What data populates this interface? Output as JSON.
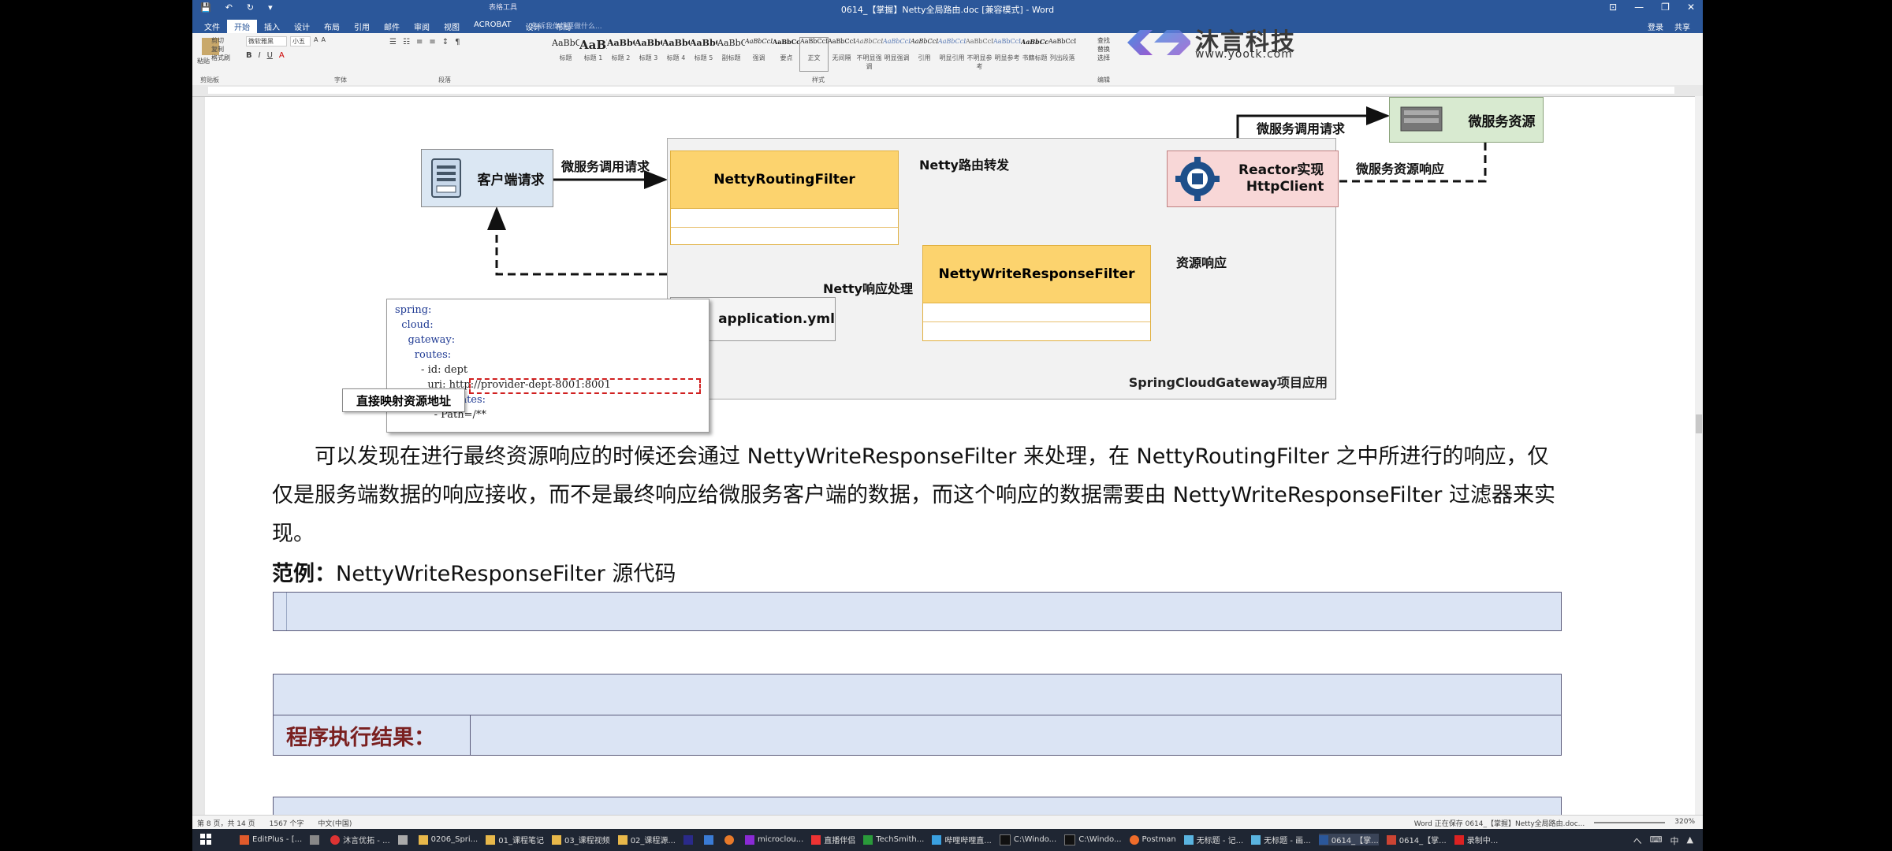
{
  "window": {
    "title": "0614_【掌握】Netty全局路由.doc [兼容模式] - Word",
    "context_tab": "表格工具",
    "controls": [
      "⊡",
      "—",
      "❐",
      "✕"
    ]
  },
  "quick_access": [
    "💾",
    "↶",
    "↻",
    "▾"
  ],
  "menu": {
    "tabs": [
      "文件",
      "开始",
      "插入",
      "设计",
      "布局",
      "引用",
      "邮件",
      "审阅",
      "视图",
      "ACROBAT",
      "设计",
      "布局"
    ],
    "active_index": 1,
    "tell_me": "告诉我你想要做什么...",
    "login": "登录",
    "share": "共享"
  },
  "ribbon": {
    "clipboard": {
      "paste": "粘贴",
      "cut": "剪切",
      "copy": "复制",
      "painter": "格式刷",
      "label": "剪贴板"
    },
    "font": {
      "name": "微软雅黑",
      "size": "小五",
      "label": "字体"
    },
    "paragraph": {
      "label": "段落"
    },
    "styles_label": "样式",
    "styles": [
      {
        "preview": "AaBbC",
        "name": "标题"
      },
      {
        "preview": "AaBl",
        "name": "标题 1"
      },
      {
        "preview": "AaBbC",
        "name": "标题 2"
      },
      {
        "preview": "AaBbC",
        "name": "标题 3"
      },
      {
        "preview": "AaBbC",
        "name": "标题 4"
      },
      {
        "preview": "AaBbC",
        "name": "标题 5"
      },
      {
        "preview": "AaBbC",
        "name": "副标题"
      },
      {
        "preview": "AaBbCcDd",
        "name": "强调"
      },
      {
        "preview": "AaBbCcD",
        "name": "要点"
      },
      {
        "preview": "AaBbCcDc",
        "name": "正文"
      },
      {
        "preview": "AaBbCcDc",
        "name": "无间隔"
      },
      {
        "preview": "AaBbCcDc",
        "name": "不明显强调"
      },
      {
        "preview": "AaBbCcDc",
        "name": "明显强调"
      },
      {
        "preview": "AaBbCcDc",
        "name": "引用"
      },
      {
        "preview": "AaBbCcDc",
        "name": "明显引用"
      },
      {
        "preview": "AaBbCcD",
        "name": "不明显参考"
      },
      {
        "preview": "AaBbCcI",
        "name": "明显参考"
      },
      {
        "preview": "AaBbCcI",
        "name": "书籍标题"
      },
      {
        "preview": "AaBbCcDc",
        "name": "列出段落"
      }
    ],
    "selected_style_index": 9,
    "editing": {
      "find": "查找",
      "replace": "替换",
      "select": "选择",
      "label": "编辑"
    }
  },
  "logo": {
    "cn": "沐言科技",
    "url": "www.yootk.com"
  },
  "diagram": {
    "client": "客户端请求",
    "call_request": "微服务调用请求",
    "routing_filter": "NettyRoutingFilter",
    "route_forward": "Netty路由转发",
    "reactor_line1": "Reactor实现",
    "reactor_line2": "HttpClient",
    "top_request": "微服务调用请求",
    "resource": "微服务资源",
    "resource_response": "微服务资源响应",
    "res_response": "资源响应",
    "write_filter": "NettyWriteResponseFilter",
    "netty_response": "Netty响应处理",
    "yaml_icon": "YAML",
    "yaml_file": "application.yml",
    "system_caption": "SpringCloudGateway项目应用",
    "direct_map": "直接映射资源地址",
    "code_lines": [
      "spring:",
      "  cloud:",
      "    gateway:",
      "      routes:",
      "        - id: dept",
      "          uri: http://provider-dept-8001:8001",
      "          predicates:",
      "            - Path=/**"
    ]
  },
  "document": {
    "paragraph": "可以发现在进行最终资源响应的时候还会通过 NettyWriteResponseFilter 来处理，在 NettyRoutingFilter 之中所进行的响应，仅仅是服务端数据的响应接收，而不是最终响应给微服务客户端的数据，而这个响应的数据需要由 NettyWriteResponseFilter 过滤器来实现。",
    "example_label": "范例：",
    "example_title": "NettyWriteResponseFilter 源代码",
    "result_label": "程序执行结果："
  },
  "status": {
    "page": "第 8 页，共 14 页",
    "words": "1567 个字",
    "lang": "中文(中国)",
    "saving": "Word 正在保存 0614_【掌握】Netty全局路由.doc...",
    "zoom": "320%"
  },
  "taskbar": {
    "items": [
      "EditPlus - [...",
      "",
      "沐言优拓 - ...",
      "",
      "0206_Spri...",
      "01_课程笔记",
      "03_课程视频",
      "02_课程源...",
      "",
      "",
      "",
      "microclou...",
      "直播伴侣",
      "TechSmith...",
      "哔哩哔哩直...",
      "C:\\Windo...",
      "C:\\Windo...",
      "Postman",
      "无标题 - 记...",
      "无标题 - 画...",
      "0614_【掌...",
      "0614_【掌...",
      "录制中..."
    ],
    "tray": [
      "へ",
      "⌨",
      "中",
      "▲"
    ]
  },
  "colors": {
    "word_blue": "#2b579a",
    "filter_orange": "#fcd36e",
    "reactor_pink": "#f8d7d7",
    "resource_green": "#d8ead0",
    "code_blue": "#dbe4f4"
  }
}
